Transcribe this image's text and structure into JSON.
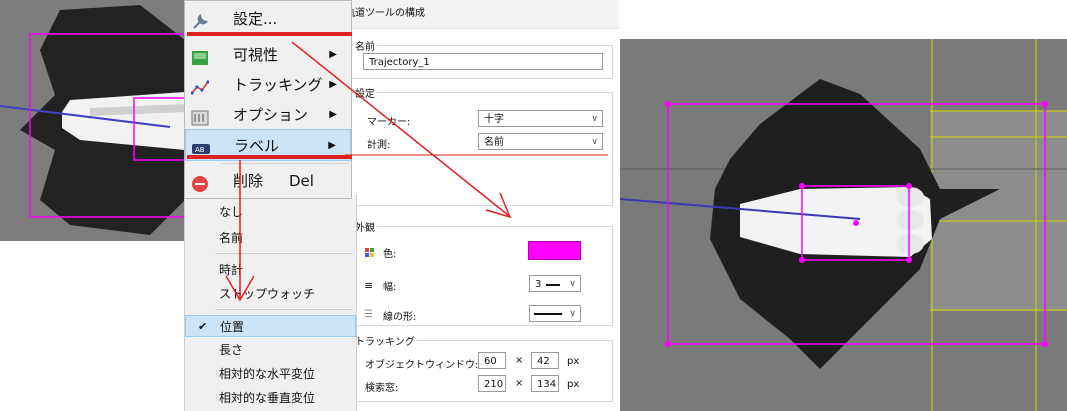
{
  "dialog": {
    "title": "軌道ツールの構成",
    "name_label": "名前",
    "name_value": "Trajectory_1",
    "settings_group": "設定",
    "marker_label": "マーカー:",
    "marker_value": "十字",
    "measure_label": "計測:",
    "measure_value": "名前",
    "appearance_group": "外観",
    "color_label": "色:",
    "color_value": "#ff00ff",
    "width_label": "幅:",
    "width_value": "3",
    "linestyle_label": "線の形:",
    "tracking_group": "トラッキング",
    "object_window_label": "オブジェクトウィンドウ:",
    "object_w": "60",
    "object_h": "42",
    "search_window_label": "検索窓:",
    "search_w": "210",
    "search_h": "134",
    "times": "×",
    "px": "px"
  },
  "menu": {
    "items": [
      {
        "label": "設定...",
        "icon": "wrench-icon"
      },
      {
        "label": "可視性",
        "icon": "visibility-icon"
      },
      {
        "label": "トラッキング",
        "icon": "tracking-icon"
      },
      {
        "label": "オプション",
        "icon": "options-icon"
      },
      {
        "label": "ラベル",
        "icon": "label-icon"
      },
      {
        "label": "削除",
        "shortcut": "Del",
        "icon": "delete-icon"
      }
    ],
    "submenu_arrow": "▶"
  },
  "submenu": {
    "items": [
      "なし",
      "名前",
      "時計",
      "ストップウォッチ",
      "位置",
      "長さ",
      "相対的な水平変位",
      "相対的な垂直変位"
    ],
    "checked": "✔"
  },
  "colors": {
    "highlight": "#cce4f7",
    "annotation_red": "#e02020",
    "magenta": "#ff00ff"
  }
}
